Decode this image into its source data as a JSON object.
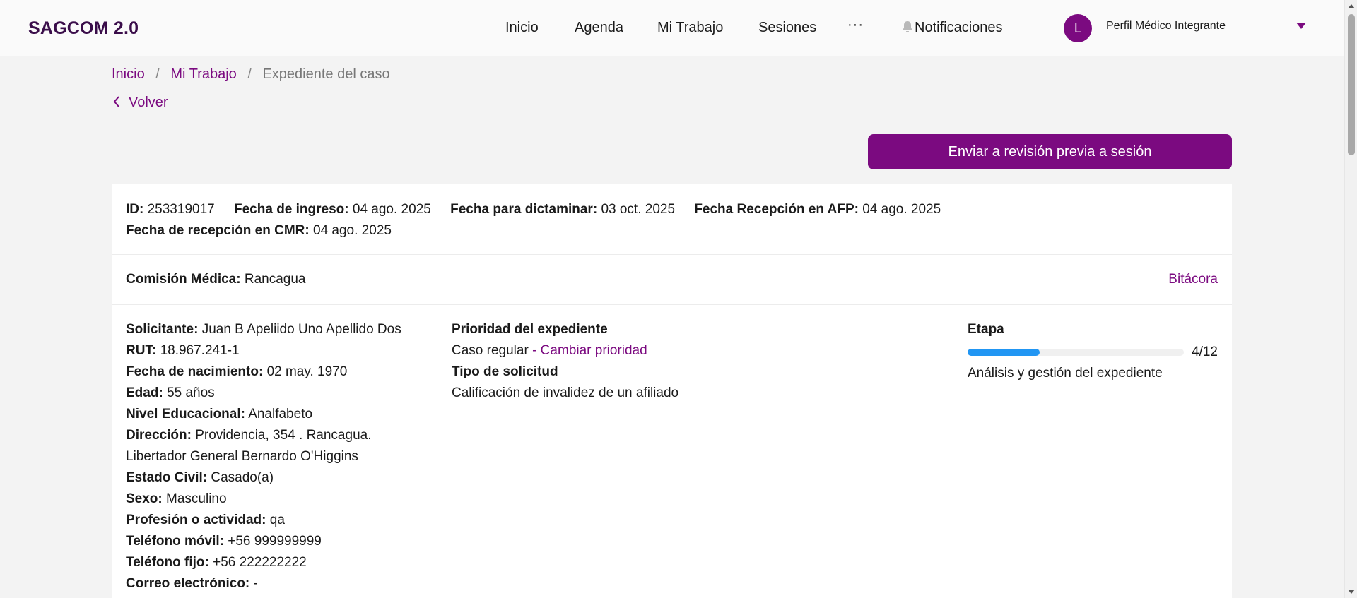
{
  "app": {
    "brand": "SAGCOM 2.0"
  },
  "nav": {
    "inicio": "Inicio",
    "agenda": "Agenda",
    "mi_trabajo": "Mi Trabajo",
    "sesiones": "Sesiones",
    "more": "···",
    "notificaciones": "Notificaciones"
  },
  "profile": {
    "initial": "L",
    "name": "Perfil Médico Integrante"
  },
  "breadcrumb": {
    "items": [
      "Inicio",
      "Mi Trabajo"
    ],
    "current": "Expediente del caso",
    "separator": "/"
  },
  "back_label": "Volver",
  "actions": {
    "send_review": "Enviar a revisión previa a sesión"
  },
  "case": {
    "id_label": "ID:",
    "id": "253319017",
    "fecha_ingreso_label": "Fecha de ingreso:",
    "fecha_ingreso": "04 ago. 2025",
    "fecha_dictaminar_label": "Fecha para dictaminar:",
    "fecha_dictaminar": "03 oct. 2025",
    "fecha_afp_label": "Fecha Recepción en AFP:",
    "fecha_afp": "04 ago. 2025",
    "fecha_cmr_label": "Fecha de recepción en CMR:",
    "fecha_cmr": "04 ago. 2025",
    "comision_label": "Comisión Médica:",
    "comision": "Rancagua",
    "bitacora": "Bitácora"
  },
  "solicitante": {
    "fields": [
      {
        "label": "Solicitante:",
        "value": "Juan B Apeliido Uno Apellido Dos"
      },
      {
        "label": "RUT:",
        "value": "18.967.241-1"
      },
      {
        "label": "Fecha de nacimiento:",
        "value": "02 may. 1970"
      },
      {
        "label": "Edad:",
        "value": "55 años"
      },
      {
        "label": "Nivel Educacional:",
        "value": "Analfabeto"
      },
      {
        "label": "Dirección:",
        "value": "Providencia, 354 . Rancagua. Libertador General Bernardo O'Higgins"
      },
      {
        "label": "Estado Civil:",
        "value": "Casado(a)"
      },
      {
        "label": "Sexo:",
        "value": "Masculino"
      },
      {
        "label": "Profesión o actividad:",
        "value": "qa"
      },
      {
        "label": "Teléfono móvil:",
        "value": "+56 999999999"
      },
      {
        "label": "Teléfono fijo:",
        "value": "+56 222222222"
      },
      {
        "label": "Correo electrónico:",
        "value": "-"
      }
    ]
  },
  "prioridad": {
    "title": "Prioridad del expediente",
    "value": "Caso regular",
    "sep": "-",
    "change_link": "Cambiar prioridad",
    "tipo_title": "Tipo de solicitud",
    "tipo_value": "Calificación de invalidez de un afiliado"
  },
  "etapa": {
    "title": "Etapa",
    "current": 4,
    "total": 12,
    "label": "4/12",
    "description": "Análisis y gestión del expediente"
  },
  "colors": {
    "accent": "#7b0a80",
    "progress": "#2196f3"
  }
}
